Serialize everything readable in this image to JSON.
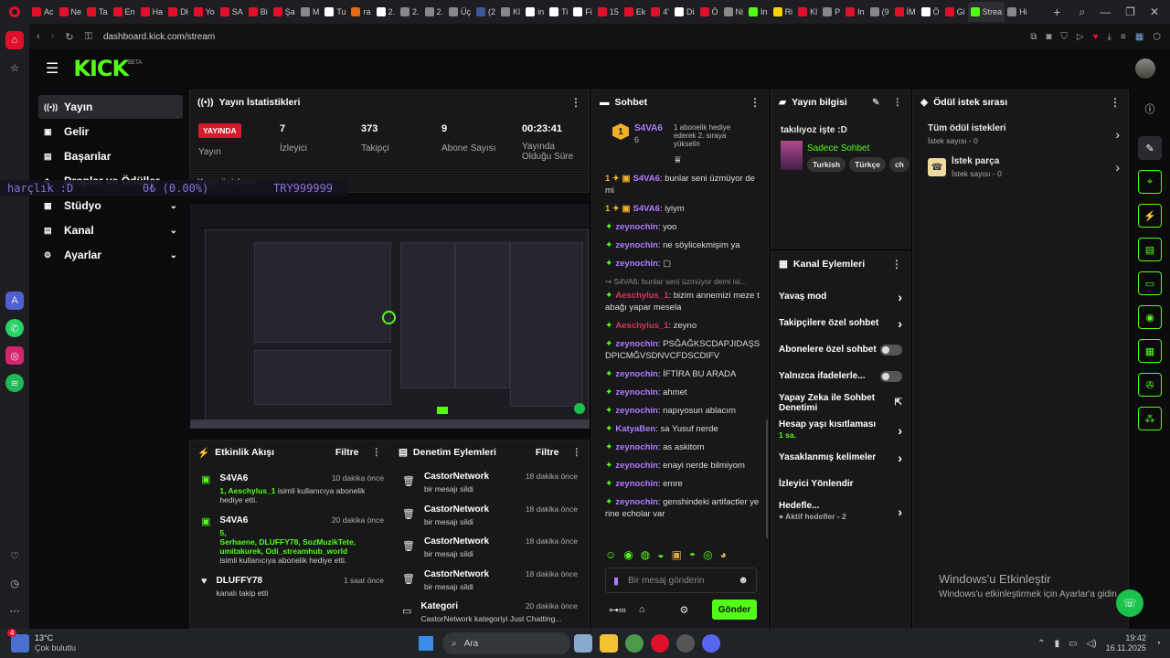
{
  "browser": {
    "tabs": [
      {
        "label": "Ac",
        "color": "#e0102a"
      },
      {
        "label": "Ne",
        "color": "#e0102a"
      },
      {
        "label": "Ta",
        "color": "#e0102a"
      },
      {
        "label": "En",
        "color": "#e0102a"
      },
      {
        "label": "Ha",
        "color": "#e0102a"
      },
      {
        "label": "Dł",
        "color": "#e0102a"
      },
      {
        "label": "Yo",
        "color": "#e0102a"
      },
      {
        "label": "SA",
        "color": "#e0102a"
      },
      {
        "label": "Bi",
        "color": "#e0102a"
      },
      {
        "label": "Şa",
        "color": "#e0102a"
      },
      {
        "label": "M",
        "color": "#888888"
      },
      {
        "label": "Tu",
        "color": "#ffffff"
      },
      {
        "label": "ra",
        "color": "#e86a10"
      },
      {
        "label": "2.",
        "color": "#ffffff"
      },
      {
        "label": "2.",
        "color": "#888888"
      },
      {
        "label": "2.",
        "color": "#888888"
      },
      {
        "label": "Üç",
        "color": "#888888"
      },
      {
        "label": "(2",
        "color": "#3b5998"
      },
      {
        "label": "Kl",
        "color": "#888888"
      },
      {
        "label": "in",
        "color": "#ffffff"
      },
      {
        "label": "Ti",
        "color": "#ffffff"
      },
      {
        "label": "Fi",
        "color": "#ffffff"
      },
      {
        "label": "15",
        "color": "#e0102a"
      },
      {
        "label": "Ek",
        "color": "#e0102a"
      },
      {
        "label": "4'",
        "color": "#e0102a"
      },
      {
        "label": "Di",
        "color": "#ffffff"
      },
      {
        "label": "Ö",
        "color": "#e0102a"
      },
      {
        "label": "Ni",
        "color": "#888888"
      },
      {
        "label": "In",
        "color": "#53fc18"
      },
      {
        "label": "Ri",
        "color": "#f6d30d"
      },
      {
        "label": "Kl",
        "color": "#e0102a"
      },
      {
        "label": "P",
        "color": "#888888"
      },
      {
        "label": "In",
        "color": "#e0102a"
      },
      {
        "label": "(9",
        "color": "#888888"
      },
      {
        "label": "İM",
        "color": "#e0102a"
      },
      {
        "label": "Ö",
        "color": "#ffffff"
      },
      {
        "label": "Gi",
        "color": "#e0102a"
      },
      {
        "label": "Strea",
        "color": "#53fc18",
        "active": true
      },
      {
        "label": "Hi",
        "color": "#888888"
      }
    ],
    "url": "dashboard.kick.com/stream",
    "window_controls": [
      "—",
      "❐",
      "✕"
    ]
  },
  "kick": {
    "logo": "KICK",
    "beta": "BETA"
  },
  "nav": {
    "items": [
      {
        "label": "Yayın",
        "active": true
      },
      {
        "label": "Gelir"
      },
      {
        "label": "Başarılar"
      },
      {
        "label": "Droplar ve Ödüller"
      },
      {
        "label": "Stüdyo",
        "chevron": "⌄"
      },
      {
        "label": "Kanal",
        "chevron": "⌄"
      },
      {
        "label": "Ayarlar",
        "chevron": "⌄"
      }
    ]
  },
  "overlay": {
    "left": "harçlık :D",
    "mid": "0₺ (0.00%)",
    "right": "TRY999999"
  },
  "stats": {
    "title": "Yayın İstatistikleri",
    "live_badge": "YAYINDA",
    "live_label": "Yayın",
    "viewers_value": "7",
    "viewers_label": "İzleyici",
    "followers_value": "373",
    "followers_label": "Takipçi",
    "subs_value": "9",
    "subs_label": "Abone Sayısı",
    "uptime_value": "00:23:41",
    "uptime_label": "Yayında Olduğu Süre",
    "bottom_label": "Yayın önizleme"
  },
  "activity": {
    "title": "Etkinlik Akışı",
    "filter": "Filtre",
    "items": [
      {
        "name": "S4VA6",
        "time": "10 dakika önce",
        "detail": "1, Aeschylus_1",
        "detail2": " isimli kullanıcıya abonelik hediye etti."
      },
      {
        "name": "S4VA6",
        "time": "20 dakika önce",
        "detail": "5,",
        "detail2": "Serhaene, DLUFFY78, SozMuzikTete, umitakurek, Odi_streamhub_world",
        "detail3": "isimli kullanıcıya abonelik hediye etti."
      },
      {
        "name": "DLUFFY78",
        "time": "1 saat önce",
        "detail": "kanalı takip etti"
      }
    ]
  },
  "moderation": {
    "title": "Denetim Eylemleri",
    "filter": "Filtre",
    "items": [
      {
        "name": "CastorNetwork",
        "time": "18 dakika önce",
        "detail": "bir mesajı sildi"
      },
      {
        "name": "CastorNetwork",
        "time": "18 dakika önce",
        "detail": "bir mesajı sildi"
      },
      {
        "name": "CastorNetwork",
        "time": "18 dakika önce",
        "detail": "bir mesajı sildi"
      },
      {
        "name": "CastorNetwork",
        "time": "18 dakika önce",
        "detail": "bir mesajı sildi"
      },
      {
        "name": "Kategori",
        "time": "20 dakika önce",
        "detail": "CastorNetwork kategoriyi Just Chatting..."
      }
    ]
  },
  "chat": {
    "title": "Sohbet",
    "pinned_name": "S4VA6",
    "pinned_count": "6",
    "pinned_note": "1 abonelik hediye ederek 2. sıraya yükselin",
    "messages": [
      {
        "u": "S4VA6",
        "c": "",
        "m": "bunlar seni üzmüyor demi",
        "badges": "1 ✦ ▣"
      },
      {
        "u": "S4VA6",
        "c": "",
        "m": "iyiym",
        "badges": "1 ✦ ▣"
      },
      {
        "u": "zeynochin",
        "c": "",
        "m": "yoo"
      },
      {
        "u": "zeynochin",
        "c": "",
        "m": "ne söylicekmişim ya"
      },
      {
        "u": "zeynochin",
        "c": "",
        "m": "▢"
      },
      {
        "u": "",
        "c": "reply",
        "m": "↪ S4VA6: bunlar seni üzmüyor demi isi..."
      },
      {
        "u": "Aeschylus_1",
        "c": "pink",
        "m": "bizim annemizi meze tabağı yapar mesela"
      },
      {
        "u": "Aeschylus_1",
        "c": "pink",
        "m": "zeyno"
      },
      {
        "u": "zeynochin",
        "c": "",
        "m": "PSĞAĞKSCDAPJIDAŞSDPICMĞVSDNVCFDSCDIFV"
      },
      {
        "u": "zeynochin",
        "c": "",
        "m": "İFTİRA BU ARADA"
      },
      {
        "u": "zeynochin",
        "c": "",
        "m": "ahmet"
      },
      {
        "u": "zeynochin",
        "c": "",
        "m": "napıyosun ablacım"
      },
      {
        "u": "KatyaBen",
        "c": "purple",
        "m": "sa Yusuf nerde"
      },
      {
        "u": "zeynochin",
        "c": "",
        "m": "as askitom"
      },
      {
        "u": "zeynochin",
        "c": "",
        "m": "enayi nerde bilmiyom"
      },
      {
        "u": "zeynochin",
        "c": "",
        "m": "emre"
      },
      {
        "u": "zeynochin",
        "c": "",
        "m": "genshindeki artifactler yerine echolar var"
      }
    ],
    "input_placeholder": "Bir mesaj gönderin",
    "send": "Gönder"
  },
  "info": {
    "title": "Yayın bilgisi",
    "stream_title": "takılıyoz işte :D",
    "category": "Sadece Sohbet",
    "tags": [
      "Turkish",
      "Türkçe",
      "ch"
    ]
  },
  "actions": {
    "title": "Kanal Eylemleri",
    "items": [
      {
        "label": "Yavaş mod",
        "kind": "chev"
      },
      {
        "label": "Takipçilere özel sohbet",
        "kind": "chev"
      },
      {
        "label": "Abonelere özel sohbet",
        "kind": "toggle"
      },
      {
        "label": "Yalnızca ifadelerle...",
        "kind": "toggle"
      },
      {
        "label": "Yapay Zeka ile Sohbet Denetimi",
        "kind": "ext"
      },
      {
        "label": "Hesap yaşı kısıtlaması",
        "sub": "1 sa.",
        "kind": "chev"
      },
      {
        "label": "Yasaklanmış kelimeler",
        "kind": "chev"
      },
      {
        "label": "İzleyici Yönlendir",
        "kind": "none"
      },
      {
        "label": "Hedefle...",
        "sub": "● Aktif hedefler - 2",
        "kind": "chev"
      }
    ]
  },
  "rewards": {
    "title": "Ödül istek sırası",
    "all_label": "Tüm ödül istekleri",
    "all_count": "İstek sayısı - 0",
    "song_label": "İstek parça",
    "song_count": "İstek sayısı - 0"
  },
  "watermark": {
    "line1": "Windows'u Etkinleştir",
    "line2": "Windows'u etkinleştirmek için Ayarlar'a gidin."
  },
  "taskbar": {
    "weather_temp": "13°C",
    "weather_desc": "Çok bulutlu",
    "search": "Ara",
    "time": "19:42",
    "date": "16.11.2025",
    "notif_count": "4"
  }
}
